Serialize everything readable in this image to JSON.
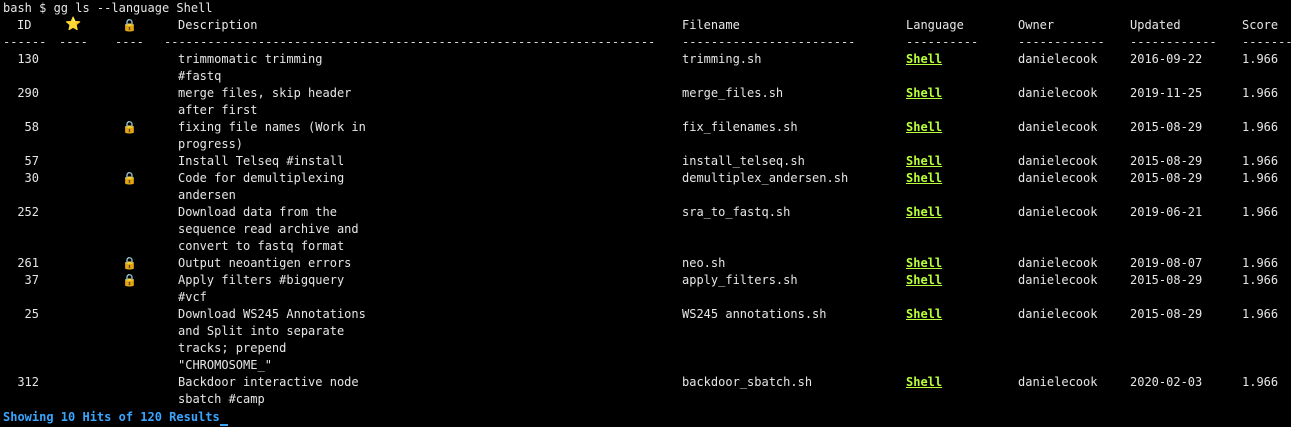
{
  "prompt": "bash $ gg ls --language Shell",
  "headers": {
    "id": "ID",
    "star": "⭐",
    "lock": "🔒",
    "description": "Description",
    "filename": "Filename",
    "language": "Language",
    "owner": "Owner",
    "updated": "Updated",
    "score": "Score"
  },
  "separators": {
    "id": "------",
    "star": "----",
    "lock": "----",
    "description": "--------------------------------------------------------------------",
    "filename": "------------------------",
    "language": "----------",
    "owner": "------------",
    "updated": "------------",
    "score": "-------"
  },
  "rows": [
    {
      "id": "130",
      "starred": false,
      "locked": false,
      "description": [
        "trimmomatic trimming",
        "#fastq"
      ],
      "filename": "trimming.sh",
      "language": "Shell",
      "owner": "danielecook",
      "updated": "2016-09-22",
      "score": "1.966"
    },
    {
      "id": "290",
      "starred": false,
      "locked": false,
      "description": [
        "merge files, skip header",
        "after first"
      ],
      "filename": "merge_files.sh",
      "language": "Shell",
      "owner": "danielecook",
      "updated": "2019-11-25",
      "score": "1.966"
    },
    {
      "id": "58",
      "starred": false,
      "locked": true,
      "description": [
        "fixing file names (Work in",
        "progress)"
      ],
      "filename": "fix_filenames.sh",
      "language": "Shell",
      "owner": "danielecook",
      "updated": "2015-08-29",
      "score": "1.966"
    },
    {
      "id": "57",
      "starred": false,
      "locked": false,
      "description": [
        "Install Telseq #install"
      ],
      "filename": "install_telseq.sh",
      "language": "Shell",
      "owner": "danielecook",
      "updated": "2015-08-29",
      "score": "1.966"
    },
    {
      "id": "30",
      "starred": false,
      "locked": true,
      "description": [
        "Code for demultiplexing",
        "andersen"
      ],
      "filename": "demultiplex_andersen.sh",
      "language": "Shell",
      "owner": "danielecook",
      "updated": "2015-08-29",
      "score": "1.966"
    },
    {
      "id": "252",
      "starred": false,
      "locked": false,
      "description": [
        "Download data from the",
        "sequence read archive and",
        "convert to fastq format"
      ],
      "filename": "sra_to_fastq.sh",
      "language": "Shell",
      "owner": "danielecook",
      "updated": "2019-06-21",
      "score": "1.966"
    },
    {
      "id": "261",
      "starred": false,
      "locked": true,
      "description": [
        "Output neoantigen errors"
      ],
      "filename": "neo.sh",
      "language": "Shell",
      "owner": "danielecook",
      "updated": "2019-08-07",
      "score": "1.966"
    },
    {
      "id": "37",
      "starred": false,
      "locked": true,
      "description": [
        "Apply filters #bigquery",
        "#vcf"
      ],
      "filename": "apply_filters.sh",
      "language": "Shell",
      "owner": "danielecook",
      "updated": "2015-08-29",
      "score": "1.966"
    },
    {
      "id": "25",
      "starred": false,
      "locked": false,
      "description": [
        "Download WS245 Annotations",
        "and Split into separate",
        "tracks; prepend",
        "\"CHROMOSOME_\""
      ],
      "filename": "WS245 annotations.sh",
      "language": "Shell",
      "owner": "danielecook",
      "updated": "2015-08-29",
      "score": "1.966"
    },
    {
      "id": "312",
      "starred": false,
      "locked": false,
      "description": [
        "Backdoor interactive node",
        "sbatch #camp"
      ],
      "filename": "backdoor_sbatch.sh",
      "language": "Shell",
      "owner": "danielecook",
      "updated": "2020-02-03",
      "score": "1.966"
    }
  ],
  "lock_glyph": "🔒",
  "status": "Showing 10 Hits of 120 Results",
  "colors": {
    "background": "#000000",
    "text": "#e6e6e6",
    "language_link": "#b8ff3c",
    "status": "#3aa5ff"
  }
}
